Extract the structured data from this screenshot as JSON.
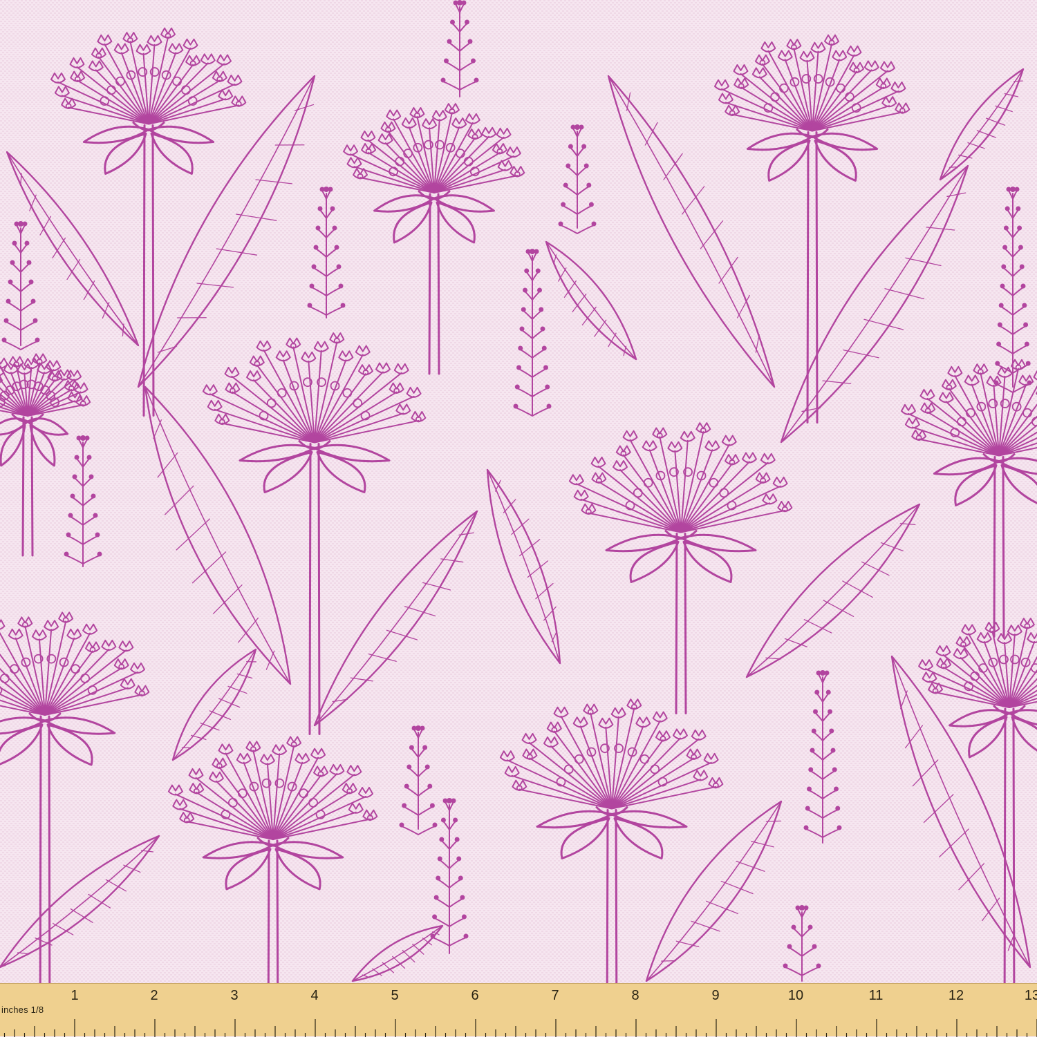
{
  "fabric": {
    "background_color": "#f6e6f0",
    "line_color": "#b2459f",
    "weave_color": "#efd8e6"
  },
  "ruler": {
    "unit_label": "inches",
    "fraction_label": "1/8",
    "numbers": [
      "1",
      "2",
      "3",
      "4",
      "5",
      "6",
      "7",
      "8",
      "9",
      "10",
      "11",
      "12",
      "13"
    ],
    "color": "#efd08f"
  }
}
